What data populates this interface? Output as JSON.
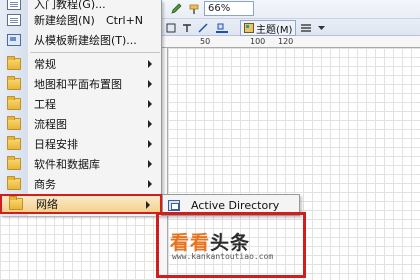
{
  "toolbar": {
    "zoom": "66%",
    "theme_label": "主题(M)",
    "ruler_ticks": [
      "50",
      "100",
      "120"
    ]
  },
  "menu": {
    "items": [
      {
        "label": "入门教程(G)...",
        "icon": "doc-icon"
      },
      {
        "label": "新建绘图(N)",
        "shortcut": "Ctrl+N",
        "icon": "doc-icon"
      },
      {
        "label": "从模板新建绘图(T)...",
        "icon": "template-icon"
      },
      {
        "label": "常规",
        "icon": "folder-icon"
      },
      {
        "label": "地图和平面布置图",
        "icon": "folder-icon"
      },
      {
        "label": "工程",
        "icon": "folder-icon"
      },
      {
        "label": "流程图",
        "icon": "folder-icon"
      },
      {
        "label": "日程安排",
        "icon": "folder-icon"
      },
      {
        "label": "软件和数据库",
        "icon": "folder-icon"
      },
      {
        "label": "商务",
        "icon": "folder-icon"
      },
      {
        "label": "网络",
        "icon": "folder-icon"
      }
    ]
  },
  "submenu": {
    "items": [
      {
        "label": "Active Directory",
        "icon": "directory-icon"
      }
    ]
  },
  "watermark": {
    "title_part1": "看看",
    "title_part2": "头条",
    "url": "www.kankantoutiao.com"
  },
  "colors": {
    "highlight_border": "#d21d1d",
    "watermark_orange": "#e8731c"
  }
}
